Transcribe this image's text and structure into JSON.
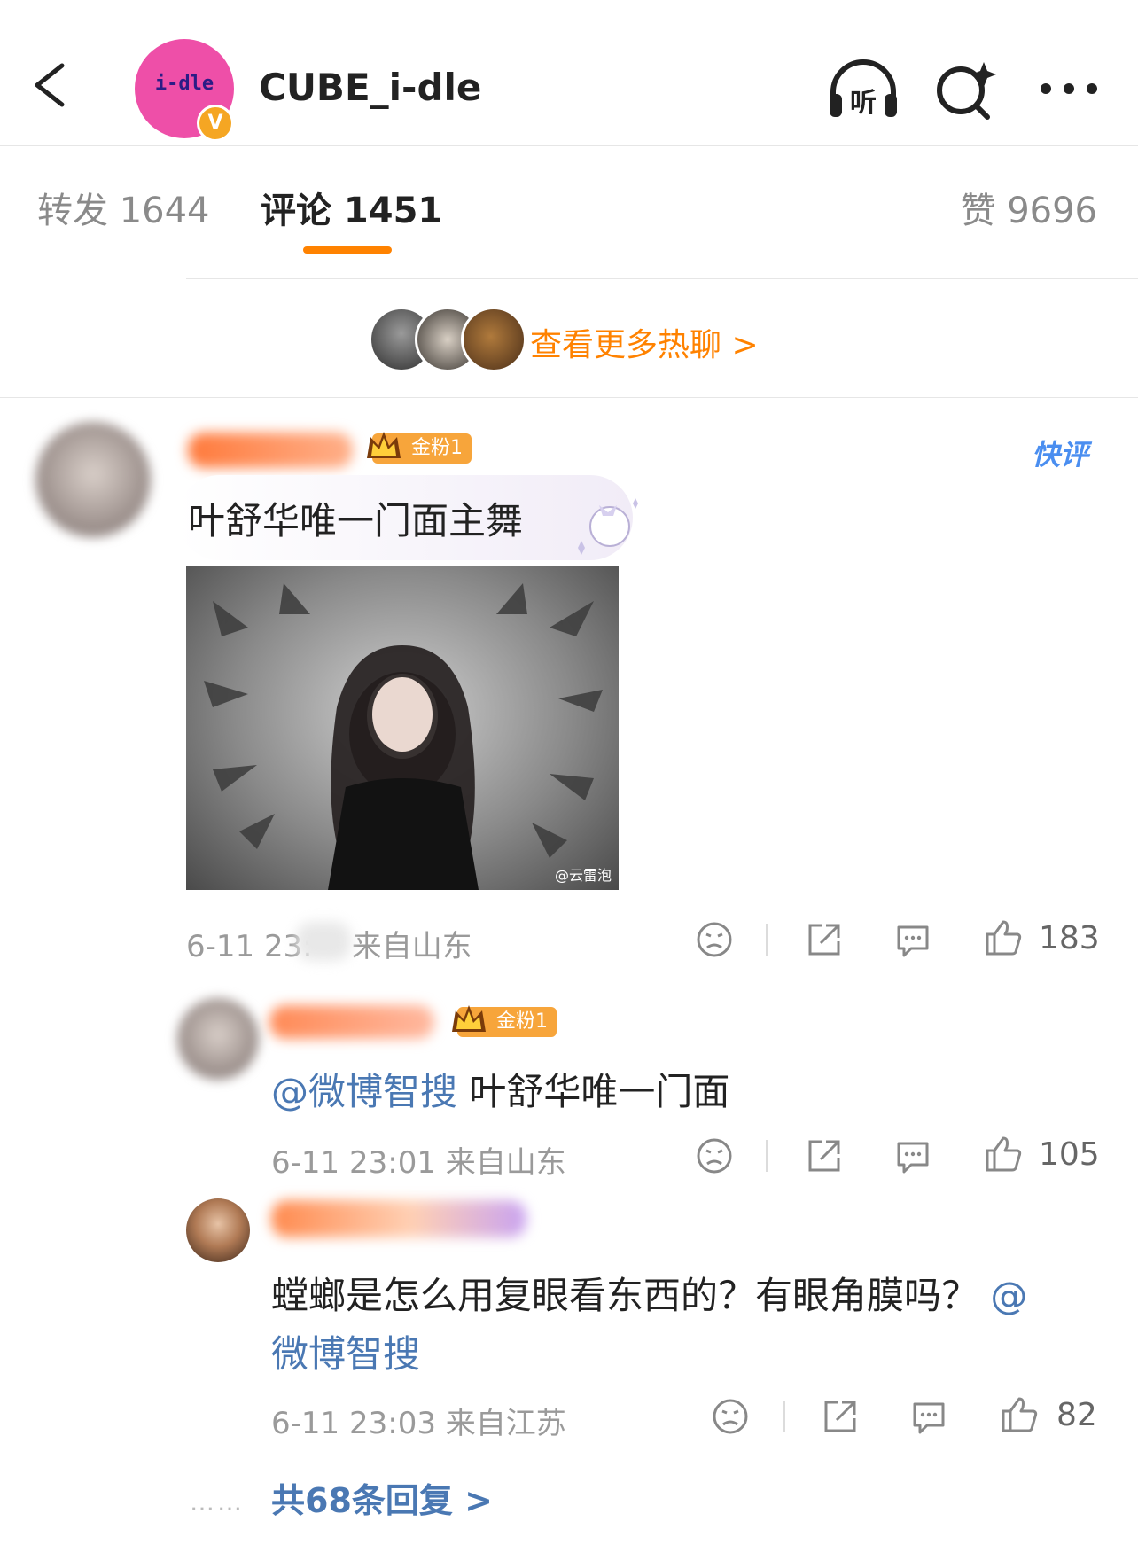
{
  "header": {
    "account_name": "CUBE_i-dle",
    "avatar_logo": "i-dle",
    "verified_mark": "V"
  },
  "tabs": {
    "repost": "转发 1644",
    "comment": "评论 1451",
    "like": "赞 9696"
  },
  "hot": {
    "label": "查看更多热聊 >"
  },
  "comment1": {
    "badge": "金粉1",
    "quick_label": "快评",
    "text": "叶舒华唯一门面主舞",
    "photo_watermark": "@云雷泡",
    "meta": "6-11 23:",
    "location": "来自山东",
    "likes": "183"
  },
  "reply1": {
    "badge": "金粉1",
    "mention": "@微博智搜",
    "text": " 叶舒华唯一门面",
    "meta": "6-11 23:01 来自山东",
    "likes": "105"
  },
  "reply2": {
    "text_line1": "螳螂是怎么用复眼看东西的？有眼角膜吗？",
    "mention_a": "@",
    "mention_b": "微博智搜",
    "meta": "6-11 23:03 来自江苏",
    "likes": "82"
  },
  "replies_link": {
    "label": "共68条回复 >",
    "dots": "……"
  },
  "colors": {
    "accent": "#ff8200",
    "link": "#4a78b3",
    "brand": "#ee4fa8"
  },
  "icons": [
    "back-icon",
    "listen-icon",
    "search-spark-icon",
    "more-icon",
    "dislike-icon",
    "share-icon",
    "reply-icon",
    "like-icon"
  ]
}
